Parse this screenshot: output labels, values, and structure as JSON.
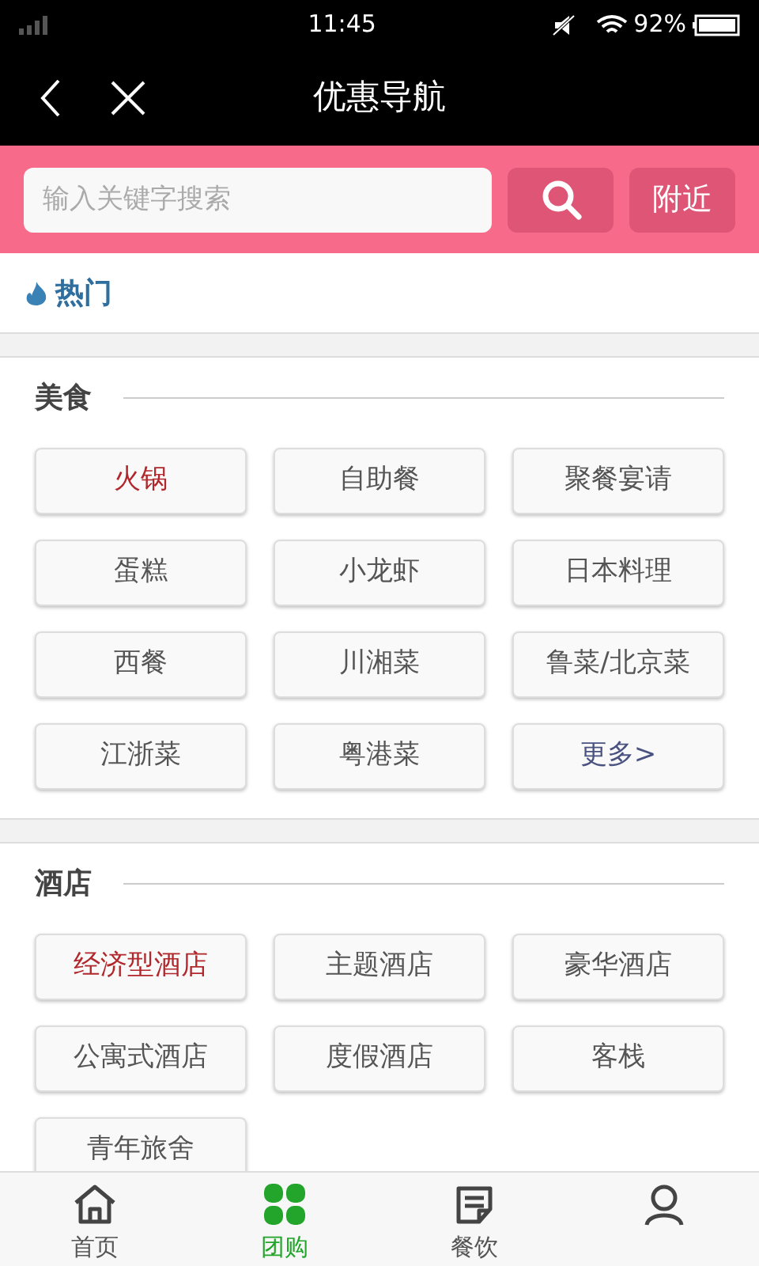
{
  "status_bar": {
    "time": "11:45",
    "battery": "92%"
  },
  "header": {
    "title": "优惠导航"
  },
  "search": {
    "placeholder": "输入关键字搜索",
    "nearby_button": "附近"
  },
  "hot": {
    "label": "热门"
  },
  "sections": [
    {
      "title": "美食",
      "items": [
        {
          "label": "火锅",
          "highlighted": true
        },
        {
          "label": "自助餐",
          "highlighted": false
        },
        {
          "label": "聚餐宴请",
          "highlighted": false
        },
        {
          "label": "蛋糕",
          "highlighted": false
        },
        {
          "label": "小龙虾",
          "highlighted": false
        },
        {
          "label": "日本料理",
          "highlighted": false
        },
        {
          "label": "西餐",
          "highlighted": false
        },
        {
          "label": "川湘菜",
          "highlighted": false
        },
        {
          "label": "鲁菜/北京菜",
          "highlighted": false
        },
        {
          "label": "江浙菜",
          "highlighted": false
        },
        {
          "label": "粤港菜",
          "highlighted": false
        },
        {
          "label": "更多>",
          "highlighted": false,
          "kind": "more"
        }
      ]
    },
    {
      "title": "酒店",
      "items": [
        {
          "label": "经济型酒店",
          "highlighted": true
        },
        {
          "label": "主题酒店",
          "highlighted": false
        },
        {
          "label": "豪华酒店",
          "highlighted": false
        },
        {
          "label": "公寓式酒店",
          "highlighted": false
        },
        {
          "label": "度假酒店",
          "highlighted": false
        },
        {
          "label": "客栈",
          "highlighted": false
        },
        {
          "label": "青年旅舍",
          "highlighted": false
        }
      ]
    }
  ],
  "tab_bar": [
    {
      "label": "首页",
      "kind": "home",
      "selected": false
    },
    {
      "label": "团购",
      "kind": "clover",
      "selected": true
    },
    {
      "label": "餐饮",
      "kind": "note",
      "selected": false
    },
    {
      "kind": "person",
      "selected": false
    }
  ]
}
